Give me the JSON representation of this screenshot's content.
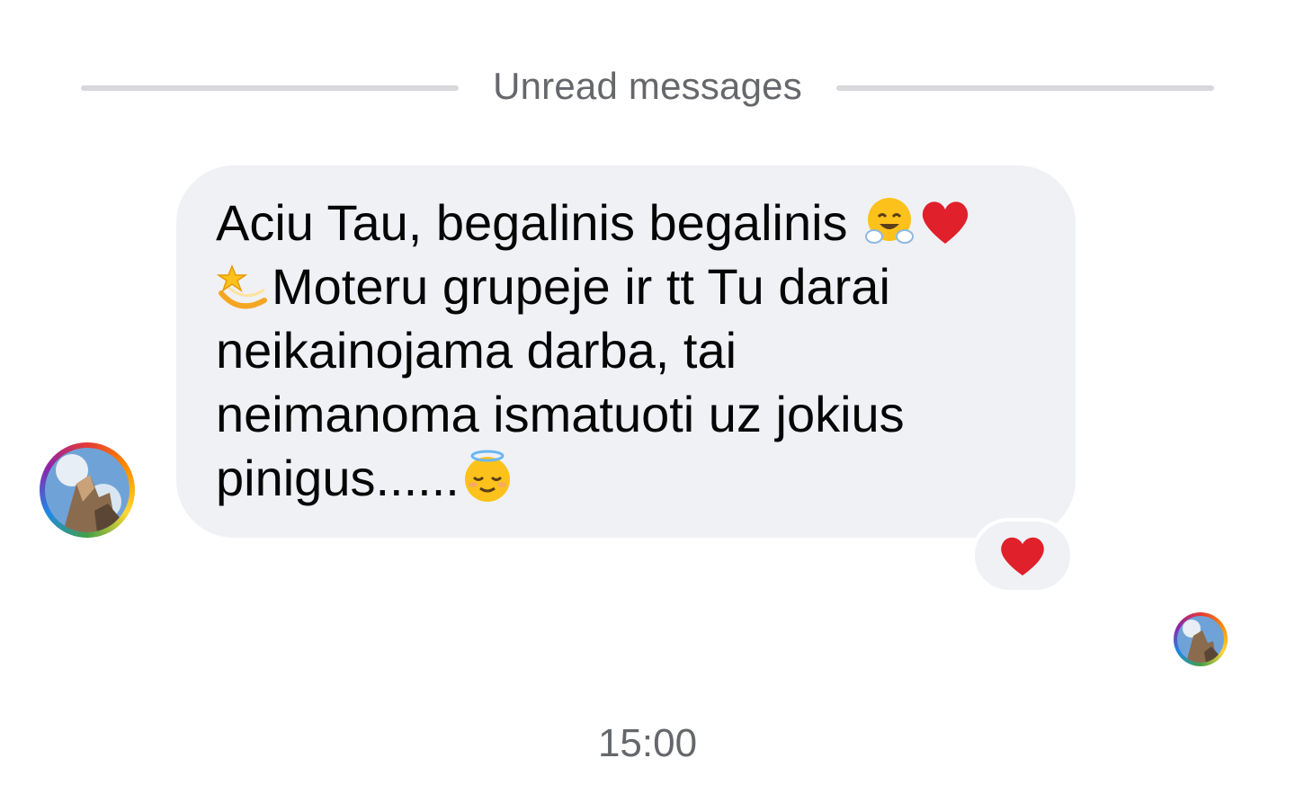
{
  "divider": {
    "label": "Unread messages"
  },
  "message": {
    "lines": [
      {
        "text": "Aciu Tau, begalinis begalinis ",
        "trailing_emojis": [
          "hugging-face-emoji",
          "red-heart-emoji"
        ]
      },
      {
        "leading_emoji": "dizzy-star-emoji",
        "text": "Moteru grupeje ir tt Tu darai"
      },
      {
        "text": "neikainojama darba, tai"
      },
      {
        "text": "neimanoma ismatuoti uz jokius"
      },
      {
        "text": "pinigus......",
        "trailing_emojis": [
          "relieved-face-emoji"
        ]
      }
    ]
  },
  "reaction": {
    "emoji": "red-heart-emoji",
    "color": "#e0202a"
  },
  "timestamp": "15:00",
  "colors": {
    "bubble_bg": "#f0f1f5",
    "meta_text": "#65676b",
    "divider_line": "#d6d8dc"
  }
}
